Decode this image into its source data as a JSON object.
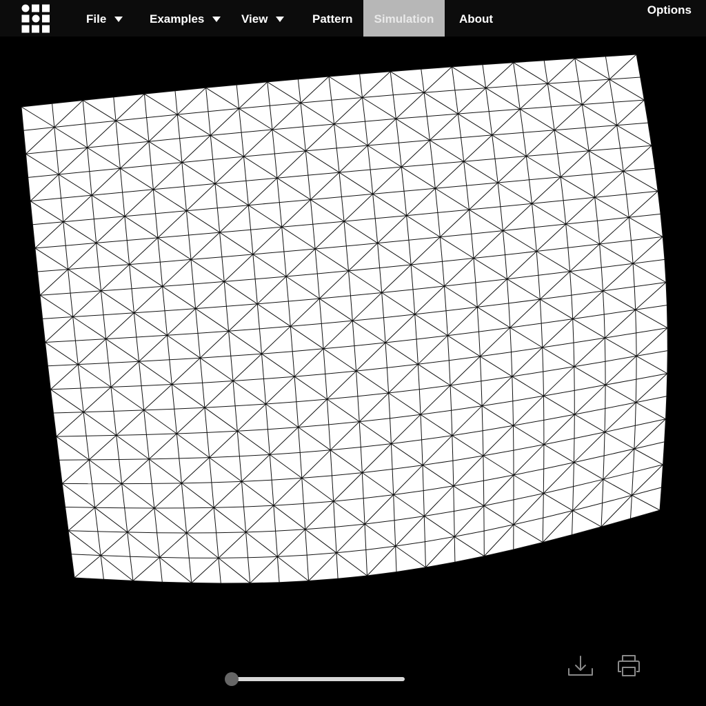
{
  "nav": {
    "file": "File",
    "examples": "Examples",
    "view": "View",
    "pattern": "Pattern",
    "simulation": "Simulation",
    "about": "About",
    "options": "Options"
  },
  "simulation": {
    "fold_percent": 0,
    "mesh_color": "#ffffff",
    "edge_color": "#111111"
  },
  "toolbar": {
    "icons": [
      "download-icon",
      "print-icon"
    ]
  },
  "colors": {
    "background": "#000000",
    "navbar": "#0c0c0c",
    "active_tab": "#b7b7b7"
  }
}
